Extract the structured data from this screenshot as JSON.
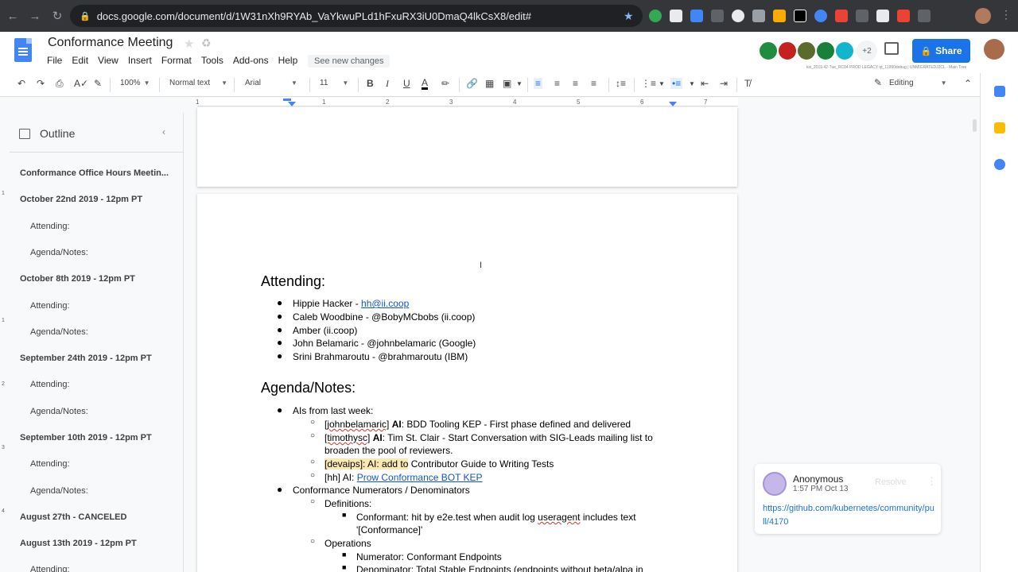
{
  "browser": {
    "url": "docs.google.com/document/d/1W31nXh9RYAb_VaYkwuPLd1hFxuRX3iU0DmaQ4lkCsX8/edit#"
  },
  "header": {
    "doc_title": "Conformance Meeting",
    "menu": [
      "File",
      "Edit",
      "View",
      "Insert",
      "Format",
      "Tools",
      "Add-ons",
      "Help"
    ],
    "see_new_changes": "See new changes",
    "collaborators_more": "+2",
    "share_label": "Share",
    "debug_text": "kix_2019.42-Tue_RC04 PROD LEGACY qt_11990debug | UNMIGRATEDJ2CL - Main Tree"
  },
  "toolbar": {
    "zoom": "100%",
    "style": "Normal text",
    "font": "Arial",
    "size": "11",
    "mode": "Editing"
  },
  "ruler": {
    "numbers": [
      "1",
      "1",
      "2",
      "3",
      "4",
      "5",
      "6",
      "7"
    ]
  },
  "outline": {
    "title": "Outline",
    "items": [
      {
        "text": "Conformance Office Hours Meetin...",
        "level": 1
      },
      {
        "text": "October 22nd 2019 - 12pm PT",
        "level": 1
      },
      {
        "text": "Attending:",
        "level": 2
      },
      {
        "text": "Agenda/Notes:",
        "level": 2
      },
      {
        "text": "October 8th 2019 - 12pm PT",
        "level": 1
      },
      {
        "text": "Attending:",
        "level": 2
      },
      {
        "text": "Agenda/Notes:",
        "level": 2
      },
      {
        "text": "September 24th 2019 - 12pm PT",
        "level": 1
      },
      {
        "text": "Attending:",
        "level": 2
      },
      {
        "text": "Agenda/Notes:",
        "level": 2
      },
      {
        "text": "September 10th 2019 - 12pm PT",
        "level": 1
      },
      {
        "text": "Attending:",
        "level": 2
      },
      {
        "text": "Agenda/Notes:",
        "level": 2
      },
      {
        "text": "August 27th - CANCELED",
        "level": 1
      },
      {
        "text": "August 13th 2019 - 12pm PT",
        "level": 1
      },
      {
        "text": "Attending:",
        "level": 2
      }
    ]
  },
  "doc": {
    "attending_heading": "Attending:",
    "attendees": [
      {
        "prefix": "Hippie Hacker - ",
        "link": "hh@ii.coop"
      },
      {
        "prefix": "Caleb Woodbine - @BobyMCbobs (ii.coop)"
      },
      {
        "prefix": "Amber (ii.coop)"
      },
      {
        "prefix": "John Belamaric - @johnbelamaric (Google)"
      },
      {
        "prefix": "Srini Brahmaroutu - @brahmaroutu (IBM)"
      }
    ],
    "agenda_heading": "Agenda/Notes:",
    "ais_title": "AIs from last week:",
    "ai1_tag": "[johnbelamaric]",
    "ai1_bold": "AI",
    "ai1_text": ": BDD Tooling KEP - First phase defined and delivered",
    "ai2_tag": "[timothysc]",
    "ai2_bold": "AI",
    "ai2_text": ": Tim St. Clair -  Start Conversation with SIG-Leads mailing list to",
    "ai2_cont": "broaden the pool of reviewers.",
    "ai3_hl": "[devaips]: AI: add to",
    "ai3_text": " Contributor Guide to Writing Tests",
    "ai4_text": "[hh] AI: ",
    "ai4_link": "Prow Conformance BOT KEP",
    "numerators_title": "Conformance Numerators / Denominators",
    "definitions": "Definitions:",
    "conformant_a": "Conformant: hit by e2e.test when audit log ",
    "conformant_squig": "useragent",
    "conformant_b": " includes text",
    "conformant_cont": "'[Conformance]'",
    "operations": "Operations",
    "numerator": "Numerator: Conformant Endpoints",
    "denominator": "Denominator: Total Stable Endpoints (endpoints without beta/alpa in"
  },
  "comment": {
    "author": "Anonymous",
    "time": "1:57 PM Oct 13",
    "resolve": "Resolve",
    "link": "https://github.com/kubernetes/community/pull/4170"
  }
}
